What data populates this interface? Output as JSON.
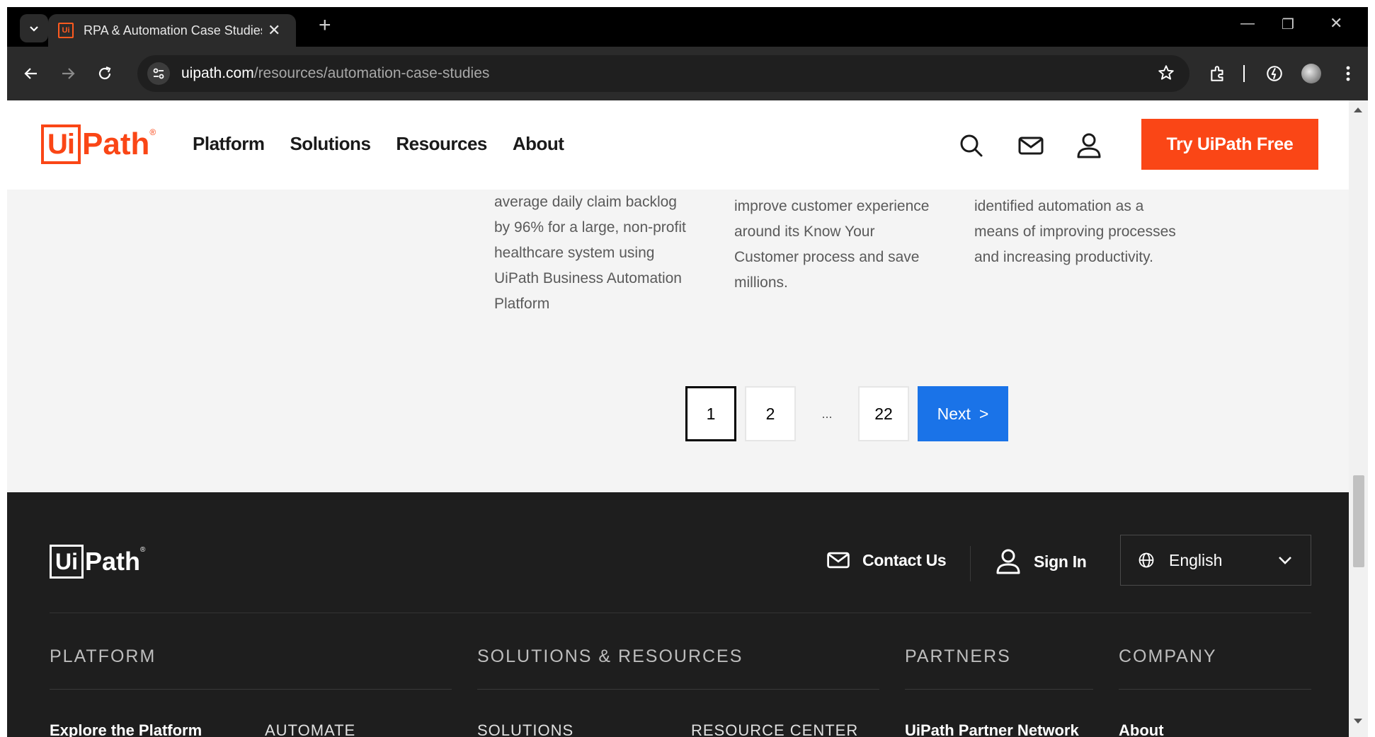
{
  "browser": {
    "tab_title": "RPA & Automation Case Studies",
    "tab_favicon_text": "Ui",
    "url_host": "uipath.com",
    "url_path": "/resources/automation-case-studies"
  },
  "header": {
    "logo_ui": "Ui",
    "logo_path": "Path",
    "logo_reg": "®",
    "nav": [
      "Platform",
      "Solutions",
      "Resources",
      "About"
    ],
    "cta": "Try UiPath Free"
  },
  "cards": [
    {
      "lines": [
        "average daily claim backlog",
        "by 96% for a large, non-profit",
        "healthcare system using",
        "UiPath Business Automation",
        "Platform"
      ]
    },
    {
      "lines": [
        "improve customer experience",
        "around its Know Your",
        "Customer process and save",
        "millions."
      ]
    },
    {
      "lines": [
        "identified automation as a",
        "means of improving processes",
        "and increasing productivity."
      ]
    }
  ],
  "pagination": {
    "pages": [
      "1",
      "2",
      "...",
      "22"
    ],
    "current": "1",
    "next_label": "Next",
    "next_arrow": ">"
  },
  "footer": {
    "logo_ui": "Ui",
    "logo_path": "Path",
    "logo_reg": "®",
    "contact": "Contact Us",
    "signin": "Sign In",
    "language": "English",
    "columns": [
      "PLATFORM",
      "SOLUTIONS & RESOURCES",
      "PARTNERS",
      "COMPANY"
    ],
    "subheadings": [
      "Explore the Platform",
      "AUTOMATE",
      "SOLUTIONS",
      "RESOURCE CENTER",
      "UiPath Partner Network",
      "About"
    ]
  },
  "colors": {
    "brand": "#fa4616",
    "next_button": "#1a73e8",
    "footer_bg": "#1e1e1e"
  },
  "icons": [
    "dropdown-icon",
    "close-icon",
    "plus-icon",
    "back-icon",
    "forward-icon",
    "reload-icon",
    "tune-icon",
    "star-icon",
    "extensions-icon",
    "speed-icon",
    "avatar",
    "menu-icon",
    "search-icon",
    "mail-icon",
    "user-icon",
    "globe-icon",
    "chevron-down-icon"
  ]
}
